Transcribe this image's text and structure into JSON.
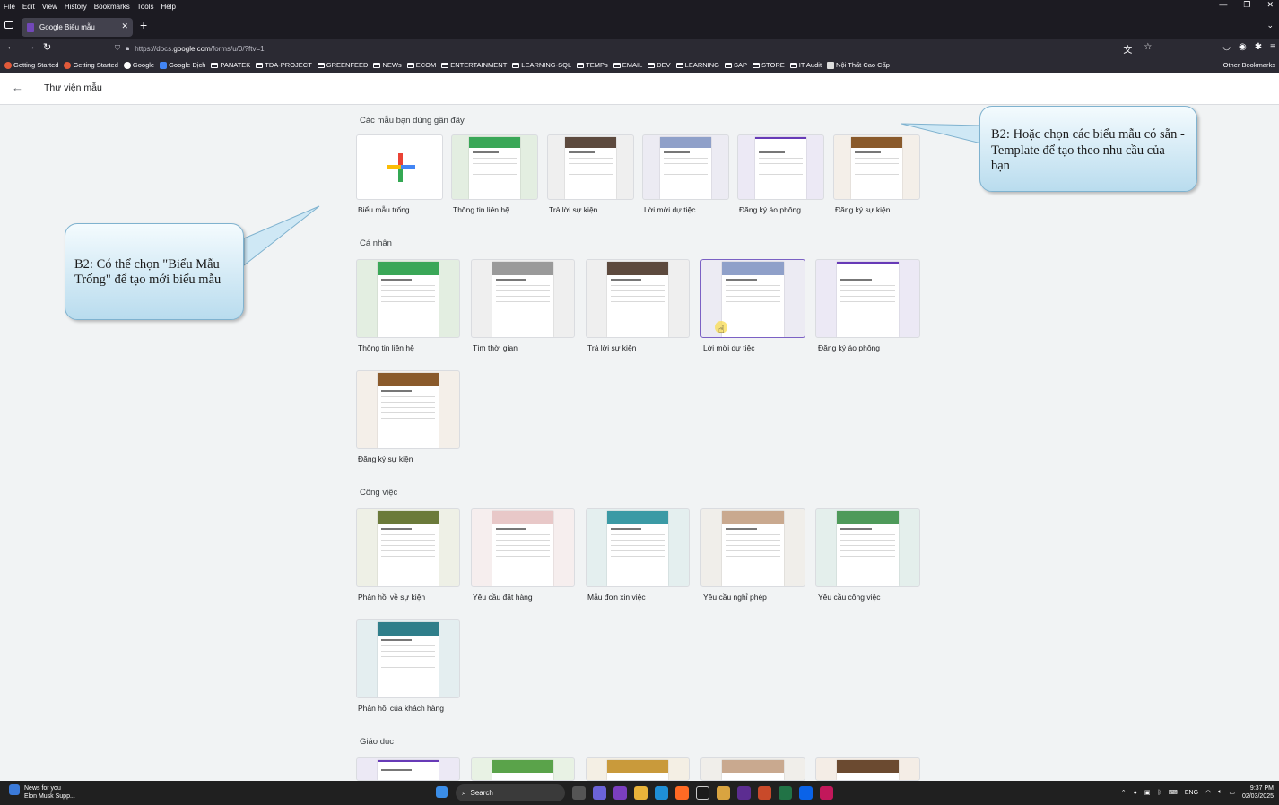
{
  "menu": [
    "File",
    "Edit",
    "View",
    "History",
    "Bookmarks",
    "Tools",
    "Help"
  ],
  "tab": {
    "title": "Google Biểu mẫu"
  },
  "url": {
    "prefix": "https://docs.",
    "domain": "google.com",
    "path": "/forms/u/0/?ftv=1"
  },
  "bookmarks": [
    "Getting Started",
    "Getting Started",
    "Google",
    "Google Dịch",
    "PANATEK",
    "TDA-PROJECT",
    "GREENFEED",
    "NEWs",
    "ECOM",
    "ENTERTAINMENT",
    "LEARNING-SQL",
    "TEMPs",
    "EMAIL",
    "DEV",
    "LEARNING",
    "SAP",
    "STORE",
    "IT Audit",
    "Nội Thất Cao Cấp"
  ],
  "other_bookmarks": "Other Bookmarks",
  "header": {
    "title": "Thư viện mẫu"
  },
  "sections": {
    "recent": "Các mẫu bạn dùng gần đây",
    "personal": "Cá nhân",
    "work": "Công việc",
    "education": "Giáo dục"
  },
  "recent_templates": [
    "Biểu mẫu trống",
    "Thông tin liên hệ",
    "Trả lời sự kiện",
    "Lời mời dự tiệc",
    "Đăng ký áo phông",
    "Đăng ký sự kiện"
  ],
  "personal_templates": [
    "Thông tin liên hệ",
    "Tìm thời gian",
    "Trả lời sự kiện",
    "Lời mời dự tiệc",
    "Đăng ký áo phông",
    "Đăng ký sự kiện"
  ],
  "work_templates": [
    "Phản hồi về sự kiện",
    "Yêu cầu đặt hàng",
    "Mẫu đơn xin việc",
    "Yêu cầu nghỉ phép",
    "Yêu cầu công việc",
    "Phản hồi của khách hàng"
  ],
  "callouts": {
    "left": "B2: Có thể chọn \"Biểu Mẫu Trống\" để tạo mới biểu mẫu",
    "right": "B2: Hoặc chọn các biểu mẫu có sẵn - Template để tạo theo nhu cầu của bạn"
  },
  "taskbar": {
    "news_title": "News for you",
    "news_sub": "Elon Musk Supp...",
    "search": "Search",
    "lang": "ENG",
    "time": "9:37 PM",
    "date": "02/03/2025"
  },
  "colors": {
    "selected_border": "#7b61c4",
    "callout_fill": "#cfe8f5",
    "header_bg": "#ffffff",
    "page_bg": "#f1f3f4"
  }
}
